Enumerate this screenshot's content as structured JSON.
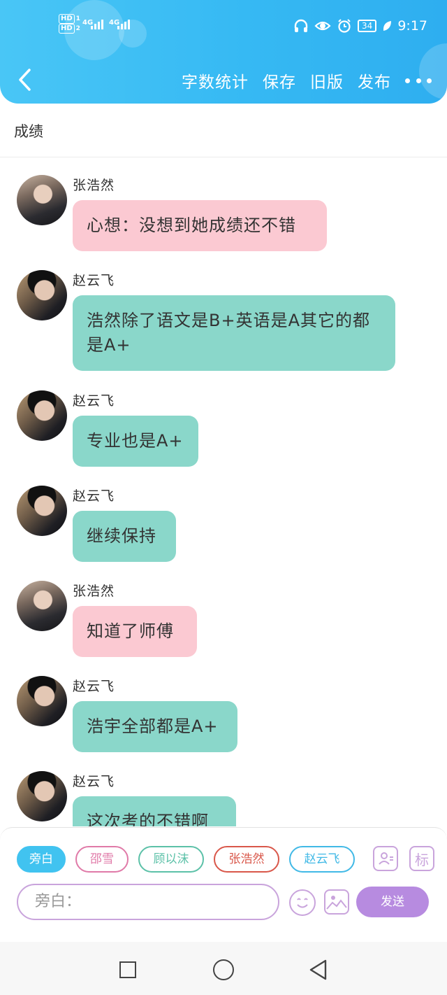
{
  "status_bar": {
    "sim1": "HD",
    "sim1_index": "1",
    "sim2": "HD",
    "sim2_index": "2",
    "net1": "4G",
    "net2": "4G",
    "battery": "34",
    "time": "9:17"
  },
  "header": {
    "actions": [
      "字数统计",
      "保存",
      "旧版",
      "发布"
    ]
  },
  "story": {
    "title": "成绩"
  },
  "messages": [
    {
      "sender": "张浩然",
      "text": "心想：没想到她成绩还不错",
      "color": "#fbc9d2"
    },
    {
      "sender": "赵云飞",
      "text": "浩然除了语文是B+英语是A其它的都是A+",
      "color": "#8ad7ca"
    },
    {
      "sender": "赵云飞",
      "text": "专业也是A+",
      "color": "#8ad7ca"
    },
    {
      "sender": "赵云飞",
      "text": "继续保持",
      "color": "#8ad7ca"
    },
    {
      "sender": "张浩然",
      "text": "知道了师傅",
      "color": "#fbc9d2"
    },
    {
      "sender": "赵云飞",
      "text": "浩宇全部都是A+",
      "color": "#8ad7ca"
    },
    {
      "sender": "赵云飞",
      "text": "这次考的不错啊",
      "color": "#8ad7ca"
    }
  ],
  "roles": [
    {
      "label": "旁白",
      "color": "#41c3f0",
      "active": true
    },
    {
      "label": "邵雪",
      "color": "#e07aa8"
    },
    {
      "label": "顾以沫",
      "color": "#5cc1a8"
    },
    {
      "label": "张浩然",
      "color": "#d9574a"
    },
    {
      "label": "赵云飞",
      "color": "#41b9e6"
    }
  ],
  "composer": {
    "mark_label": "标",
    "input_placeholder": "旁白：",
    "send_label": "发送"
  },
  "colors": {
    "header": "#36b9f3",
    "accent": "#b78be0",
    "pink_bubble": "#fbc9d2",
    "teal_bubble": "#8ad7ca"
  }
}
